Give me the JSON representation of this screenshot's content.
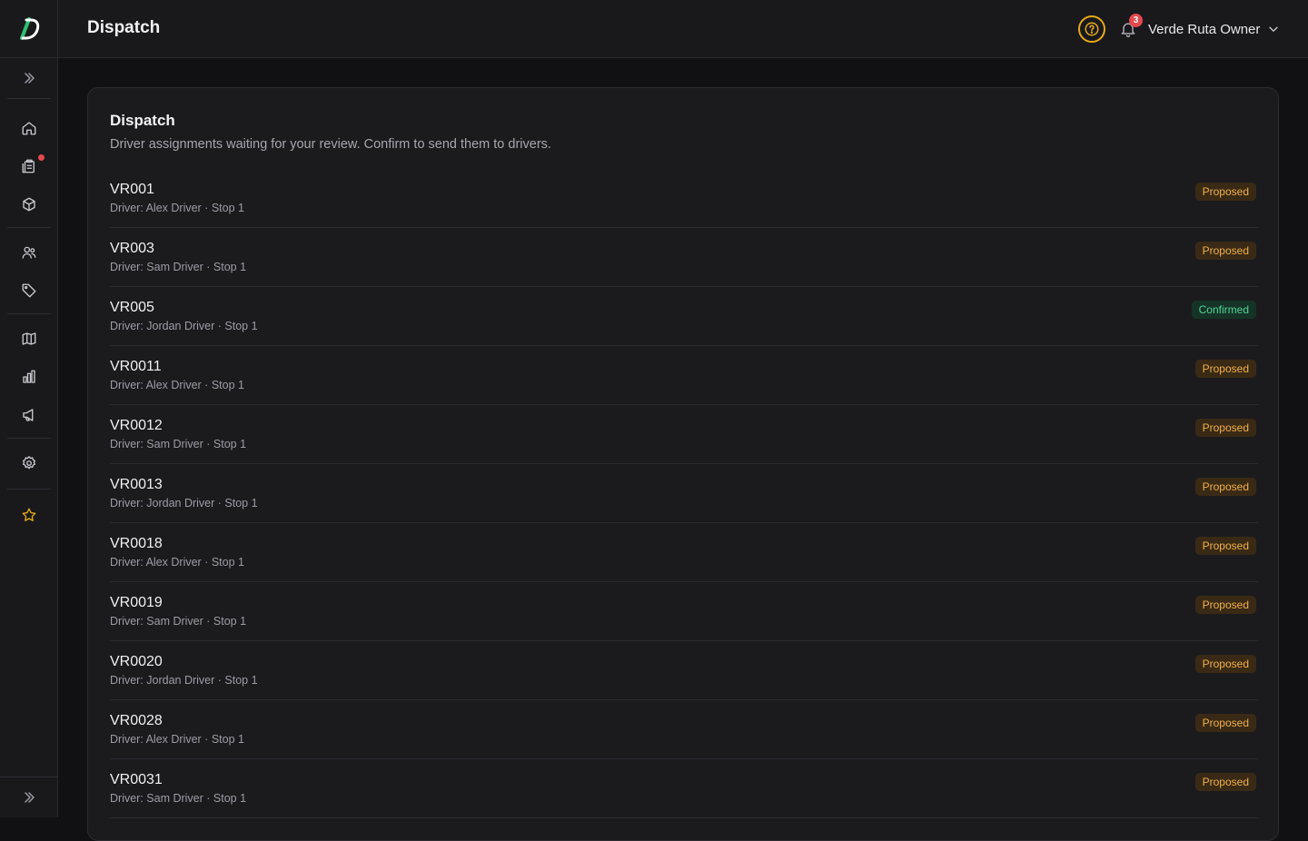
{
  "app": {
    "brand": "Dispatch",
    "accent_color": "#e6a817",
    "logo_color": "#2fbf71"
  },
  "header": {
    "title": "Dispatch",
    "help_icon": "help-circle-icon",
    "notifications_count": "3",
    "user_name": "Verde Ruta Owner"
  },
  "sidebar": {
    "items": [
      {
        "icon": "home-icon",
        "label": "Home"
      },
      {
        "icon": "clipboard-icon",
        "label": "Orders",
        "has_alert": true
      },
      {
        "icon": "box-icon",
        "label": "Products"
      },
      {
        "icon": "users-icon",
        "label": "Customers"
      },
      {
        "icon": "tag-icon",
        "label": "Pricing"
      },
      {
        "icon": "map-icon",
        "label": "Routes"
      },
      {
        "icon": "bar-chart-icon",
        "label": "Reports"
      },
      {
        "icon": "megaphone-icon",
        "label": "Marketing"
      },
      {
        "icon": "gear-icon",
        "label": "Settings"
      },
      {
        "icon": "star-icon",
        "label": "Favorites"
      }
    ]
  },
  "main": {
    "card_title": "Dispatch",
    "card_subtitle": "Driver assignments waiting for your review. Confirm to send them to drivers.",
    "assignments": [
      {
        "id": "VR001",
        "meta": "Driver: Alex Driver · Stop 1",
        "status": "Proposed"
      },
      {
        "id": "VR003",
        "meta": "Driver: Sam Driver · Stop 1",
        "status": "Proposed"
      },
      {
        "id": "VR005",
        "meta": "Driver: Jordan Driver · Stop 1",
        "status": "Confirmed"
      },
      {
        "id": "VR0011",
        "meta": "Driver: Alex Driver · Stop 1",
        "status": "Proposed"
      },
      {
        "id": "VR0012",
        "meta": "Driver: Sam Driver · Stop 1",
        "status": "Proposed"
      },
      {
        "id": "VR0013",
        "meta": "Driver: Jordan Driver · Stop 1",
        "status": "Proposed"
      },
      {
        "id": "VR0018",
        "meta": "Driver: Alex Driver · Stop 1",
        "status": "Proposed"
      },
      {
        "id": "VR0019",
        "meta": "Driver: Sam Driver · Stop 1",
        "status": "Proposed"
      },
      {
        "id": "VR0020",
        "meta": "Driver: Jordan Driver · Stop 1",
        "status": "Proposed"
      },
      {
        "id": "VR0028",
        "meta": "Driver: Alex Driver · Stop 1",
        "status": "Proposed"
      },
      {
        "id": "VR0031",
        "meta": "Driver: Sam Driver · Stop 1",
        "status": "Proposed"
      }
    ]
  }
}
